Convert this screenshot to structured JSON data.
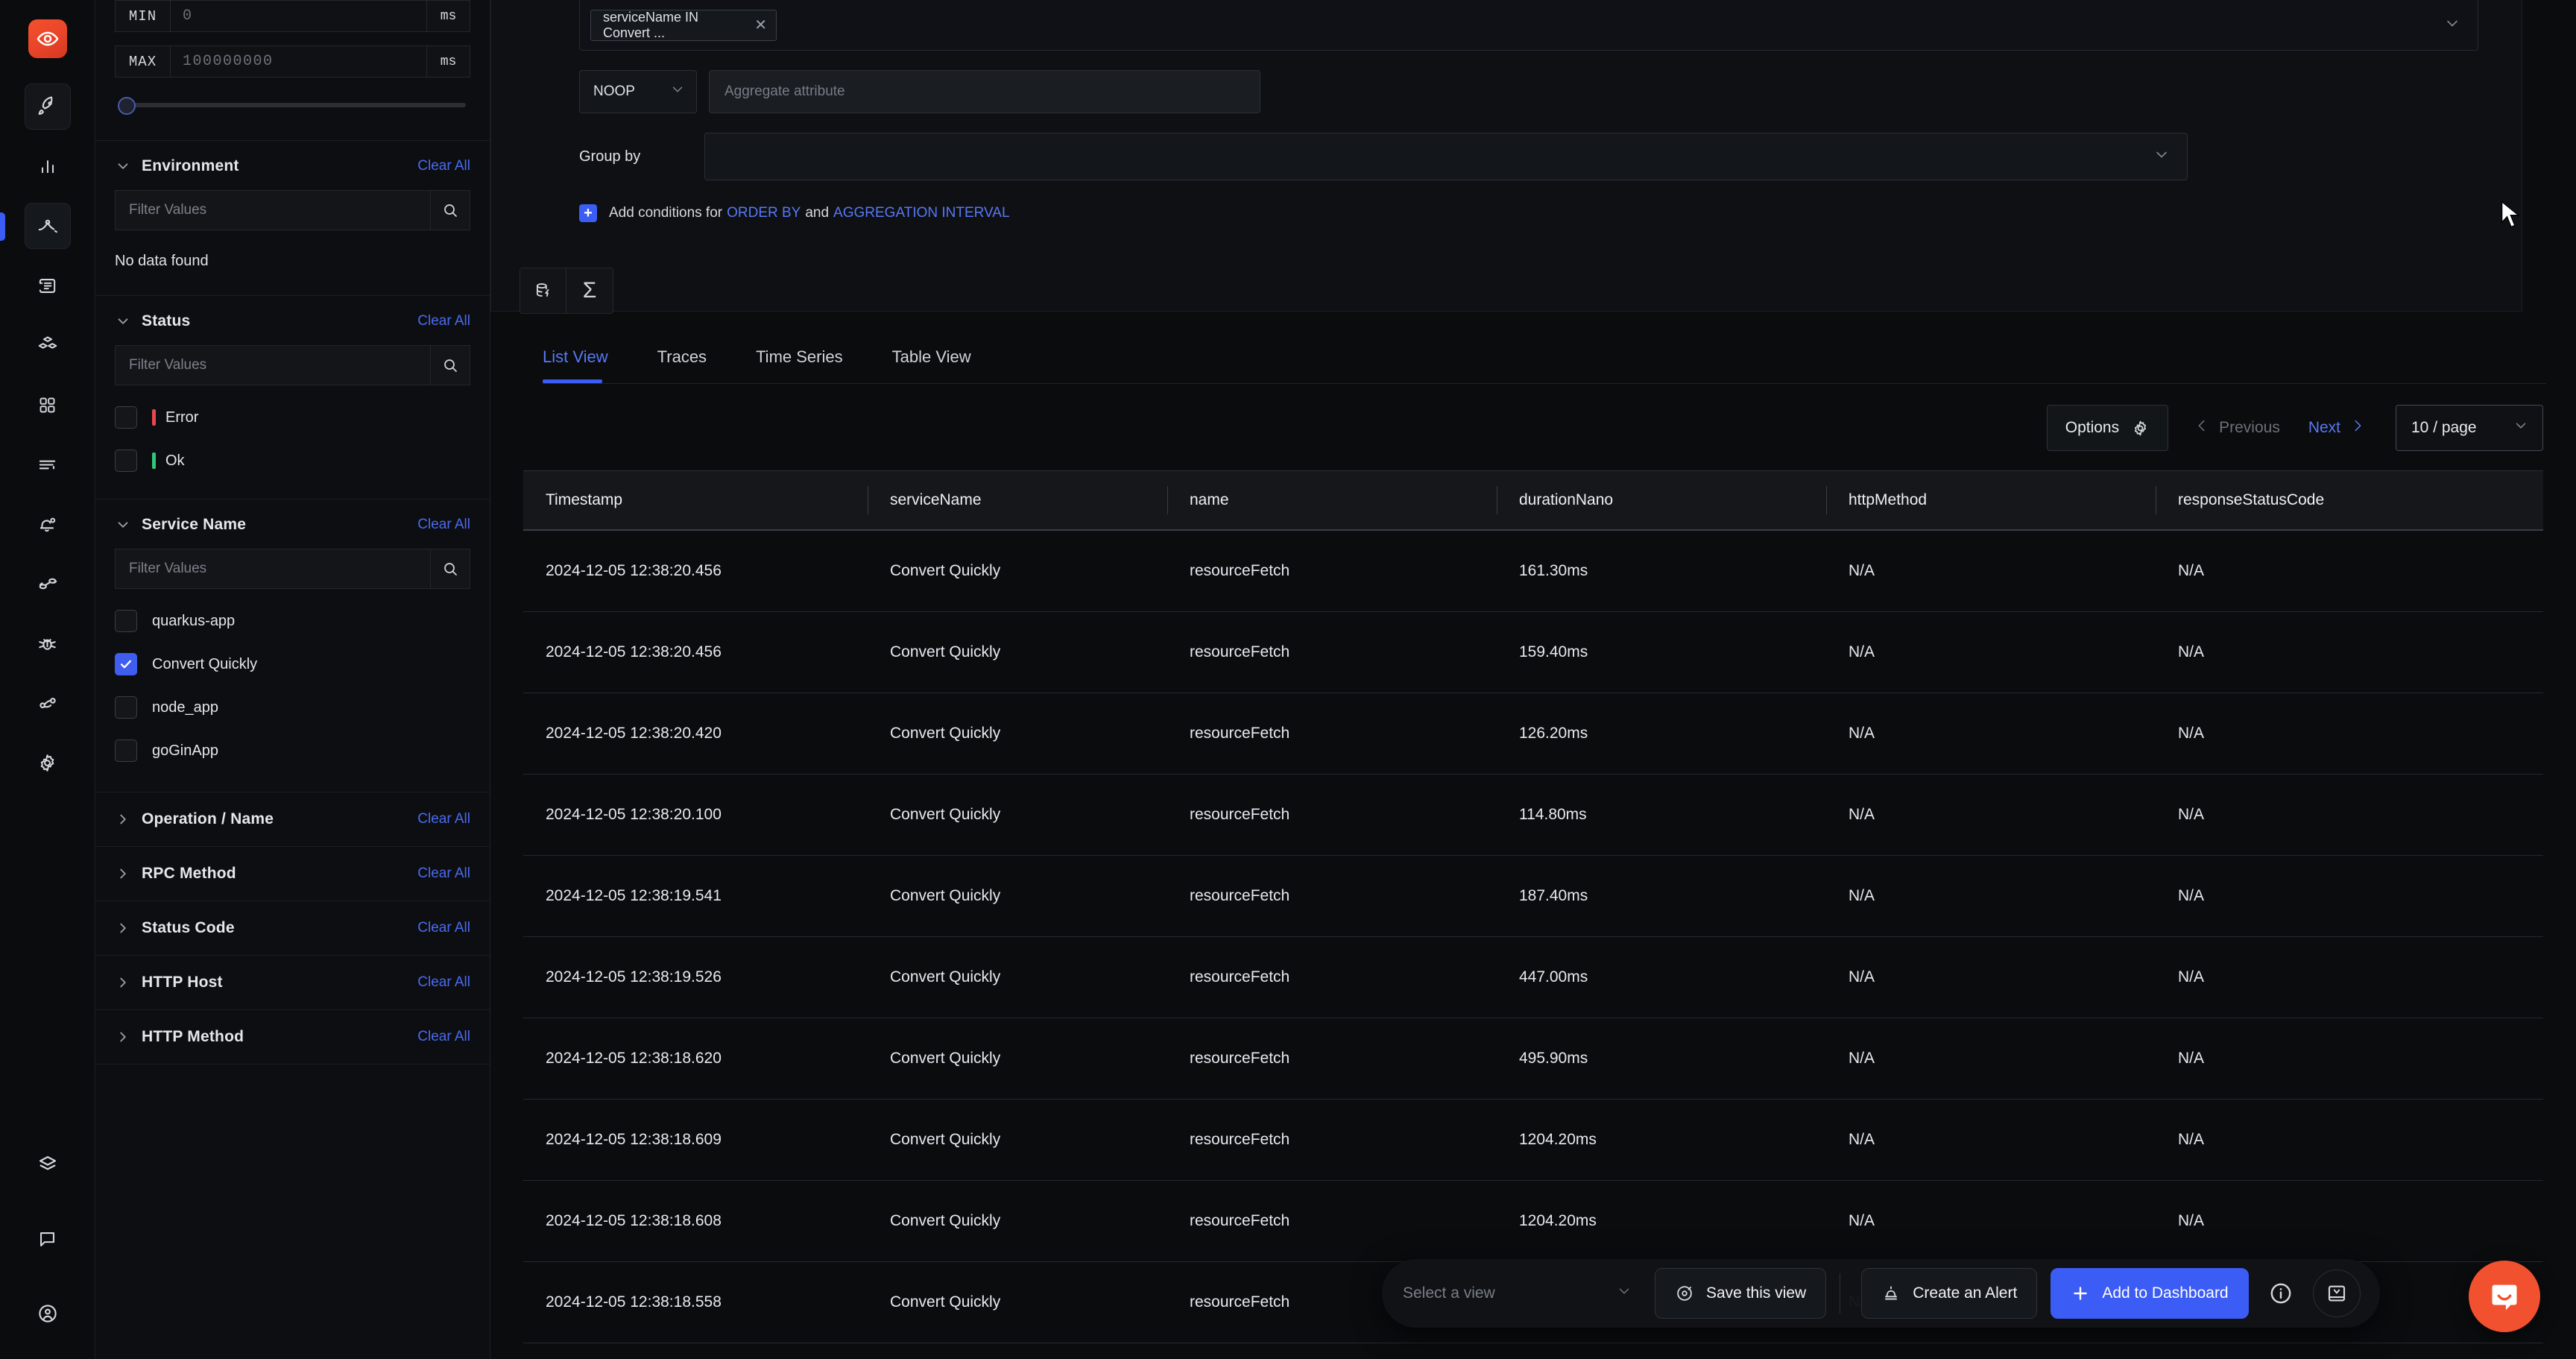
{
  "app": {
    "logo_icon": "signoz-eye-logo",
    "accent": "#3b5cf5",
    "brand": "#f1512f"
  },
  "rail": {
    "items": [
      {
        "name": "rocket-icon",
        "label": "Get Started"
      },
      {
        "name": "bar-chart-icon",
        "label": "Services"
      },
      {
        "name": "traces-compass-icon",
        "label": "Traces"
      },
      {
        "name": "logs-scroll-icon",
        "label": "Logs"
      },
      {
        "name": "cubes-icon",
        "label": "Infrastructure"
      },
      {
        "name": "grid-icon",
        "label": "Dashboards"
      },
      {
        "name": "align-left-icon",
        "label": "Exceptions"
      },
      {
        "name": "bell-icon",
        "label": "Alerts"
      },
      {
        "name": "pipeline-icon",
        "label": "Messaging Queues"
      },
      {
        "name": "bug-icon",
        "label": "Exceptions"
      },
      {
        "name": "service-map-icon",
        "label": "Service Map"
      },
      {
        "name": "gear-icon",
        "label": "Settings"
      }
    ],
    "bottom_items": [
      {
        "name": "layers-icon",
        "label": "Integrations"
      },
      {
        "name": "chat-icon",
        "label": "Support"
      },
      {
        "name": "user-circle-icon",
        "label": "Account"
      }
    ]
  },
  "filters": {
    "duration": {
      "min_label": "MIN",
      "min_value": "0",
      "min_unit": "ms",
      "max_label": "MAX",
      "max_value": "100000000",
      "max_unit": "ms"
    },
    "sections": [
      {
        "title": "Environment",
        "clear_label": "Clear All",
        "expanded": true,
        "search_placeholder": "Filter Values",
        "empty_text": "No data found",
        "options": []
      },
      {
        "title": "Status",
        "clear_label": "Clear All",
        "expanded": true,
        "search_placeholder": "Filter Values",
        "options": [
          {
            "label": "Error",
            "checked": false,
            "color": "#e5484d"
          },
          {
            "label": "Ok",
            "checked": false,
            "color": "#30c77a"
          }
        ]
      },
      {
        "title": "Service Name",
        "clear_label": "Clear All",
        "expanded": true,
        "search_placeholder": "Filter Values",
        "options": [
          {
            "label": "quarkus-app",
            "checked": false
          },
          {
            "label": "Convert Quickly",
            "checked": true
          },
          {
            "label": "node_app",
            "checked": false
          },
          {
            "label": "goGinApp",
            "checked": false
          }
        ]
      },
      {
        "title": "Operation / Name",
        "clear_label": "Clear All",
        "expanded": false
      },
      {
        "title": "RPC Method",
        "clear_label": "Clear All",
        "expanded": false
      },
      {
        "title": "Status Code",
        "clear_label": "Clear All",
        "expanded": false
      },
      {
        "title": "HTTP Host",
        "clear_label": "Clear All",
        "expanded": false
      },
      {
        "title": "HTTP Method",
        "clear_label": "Clear All",
        "expanded": false
      }
    ]
  },
  "query_builder": {
    "filter_chip": "serviceName IN Convert ...",
    "aggregate_operator": "NOOP",
    "aggregate_attribute_placeholder": "Aggregate attribute",
    "group_by_label": "Group by",
    "group_by_value": "",
    "add_conditions_prefix": "Add conditions for",
    "order_by_link": "ORDER BY",
    "and_text": "and",
    "aggregation_interval_link": "AGGREGATION INTERVAL",
    "toggle_query_icon": "database-lightning-icon",
    "toggle_formula_icon": "sigma-icon"
  },
  "tabs": [
    {
      "label": "List View",
      "active": true
    },
    {
      "label": "Traces",
      "active": false
    },
    {
      "label": "Time Series",
      "active": false
    },
    {
      "label": "Table View",
      "active": false
    }
  ],
  "toolbar": {
    "options_label": "Options",
    "options_icon": "gear-icon",
    "previous_label": "Previous",
    "next_label": "Next",
    "per_page_label": "10 / page"
  },
  "table": {
    "columns": [
      "Timestamp",
      "serviceName",
      "name",
      "durationNano",
      "httpMethod",
      "responseStatusCode"
    ],
    "rows": [
      [
        "2024-12-05 12:38:20.456",
        "Convert Quickly",
        "resourceFetch",
        "161.30ms",
        "N/A",
        "N/A"
      ],
      [
        "2024-12-05 12:38:20.456",
        "Convert Quickly",
        "resourceFetch",
        "159.40ms",
        "N/A",
        "N/A"
      ],
      [
        "2024-12-05 12:38:20.420",
        "Convert Quickly",
        "resourceFetch",
        "126.20ms",
        "N/A",
        "N/A"
      ],
      [
        "2024-12-05 12:38:20.100",
        "Convert Quickly",
        "resourceFetch",
        "114.80ms",
        "N/A",
        "N/A"
      ],
      [
        "2024-12-05 12:38:19.541",
        "Convert Quickly",
        "resourceFetch",
        "187.40ms",
        "N/A",
        "N/A"
      ],
      [
        "2024-12-05 12:38:19.526",
        "Convert Quickly",
        "resourceFetch",
        "447.00ms",
        "N/A",
        "N/A"
      ],
      [
        "2024-12-05 12:38:18.620",
        "Convert Quickly",
        "resourceFetch",
        "495.90ms",
        "N/A",
        "N/A"
      ],
      [
        "2024-12-05 12:38:18.609",
        "Convert Quickly",
        "resourceFetch",
        "1204.20ms",
        "N/A",
        "N/A"
      ],
      [
        "2024-12-05 12:38:18.608",
        "Convert Quickly",
        "resourceFetch",
        "1204.20ms",
        "N/A",
        "N/A"
      ],
      [
        "2024-12-05 12:38:18.558",
        "Convert Quickly",
        "resourceFetch",
        "",
        "N/A",
        "N/A"
      ]
    ]
  },
  "bottom_bar": {
    "select_view_placeholder": "Select a view",
    "save_view_label": "Save this view",
    "save_view_icon": "save-disc-icon",
    "create_alert_label": "Create an Alert",
    "create_alert_icon": "alert-bell-icon",
    "add_dashboard_label": "Add to Dashboard",
    "add_dashboard_icon": "plus-icon",
    "info_icon": "info-circle-icon",
    "collapse_icon": "collapse-panel-icon"
  },
  "support_widget": {
    "icon": "intercom-chat-icon",
    "color": "#f1512f"
  }
}
